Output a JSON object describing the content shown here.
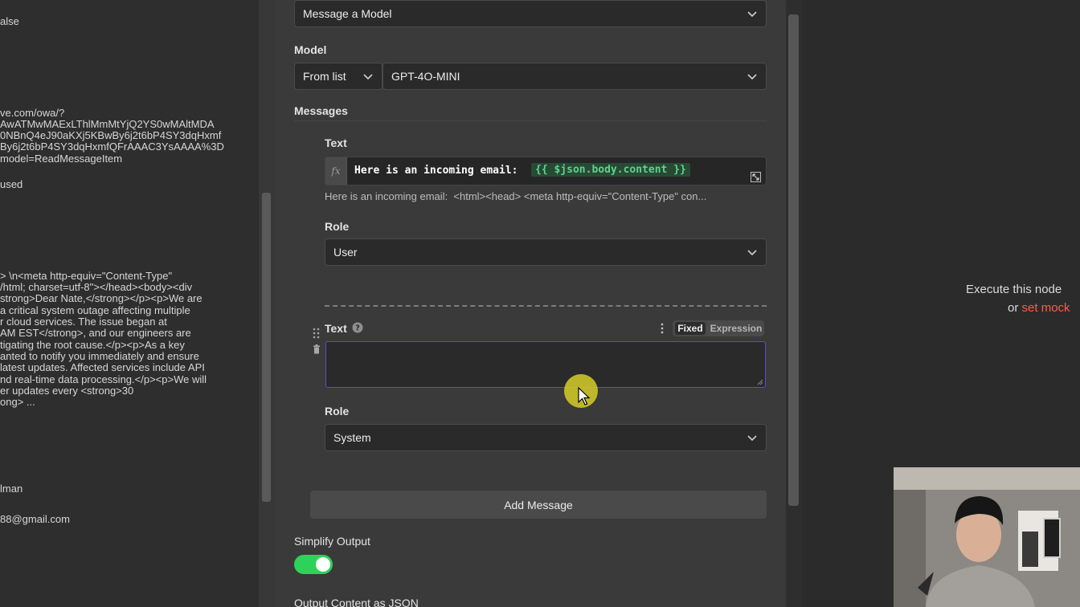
{
  "left_panel": {
    "lines": [
      "alse",
      "ve.com/owa/?",
      "AwATMwMAExLThlMmMtYjQ2YS0wMAltMDA",
      "0NBnQ4eJ90aKXj5KBwBy6j2t6bP4SY3dqHxmf",
      "By6j2t6bP4SY3dqHxmfQFrAAAC3YsAAAA%3D",
      "model=ReadMessageItem",
      "used",
      "> \\n<meta http-equiv=\"Content-Type\"",
      "/html; charset=utf-8\"></head><body><div",
      "strong>Dear Nate,</strong></p><p>We are",
      "a critical system outage affecting multiple",
      "r cloud services. The issue began at",
      "AM EST</strong>, and our engineers are",
      "tigating the root cause.</p><p>As a key",
      "anted to notify you immediately and ensure",
      "latest updates. Affected services include API",
      "nd real-time data processing.</p><p>We will",
      "er updates every <strong>30",
      "ong> ...",
      "lman",
      "88@gmail.com"
    ]
  },
  "node": {
    "operation": "Message a Model",
    "model_label": "Model",
    "model_mode": "From list",
    "model_value": "GPT-4O-MINI",
    "messages_label": "Messages",
    "message1": {
      "text_label": "Text",
      "fx": "fx",
      "expression_prefix": "Here is an incoming email:",
      "expression_var": "{{ $json.body.content }}",
      "preview": "Here is an incoming email:  <html><head> <meta http-equiv=\"Content-Type\" con...",
      "role_label": "Role",
      "role_value": "User"
    },
    "message2": {
      "text_label": "Text",
      "text_value": "",
      "fixed_label": "Fixed",
      "expression_label": "Expression",
      "role_label": "Role",
      "role_value": "System"
    },
    "add_message_label": "Add Message",
    "simplify_output_label": "Simplify Output",
    "simplify_output_on": true,
    "output_json_label": "Output Content as JSON"
  },
  "right_panel": {
    "execute_text": "Execute this node",
    "or_text": "or",
    "set_mock_text": "set mock"
  },
  "colors": {
    "accent_green": "#2ed15a",
    "focus_border": "#5b4bd0",
    "link_red": "#ff5a4a"
  }
}
